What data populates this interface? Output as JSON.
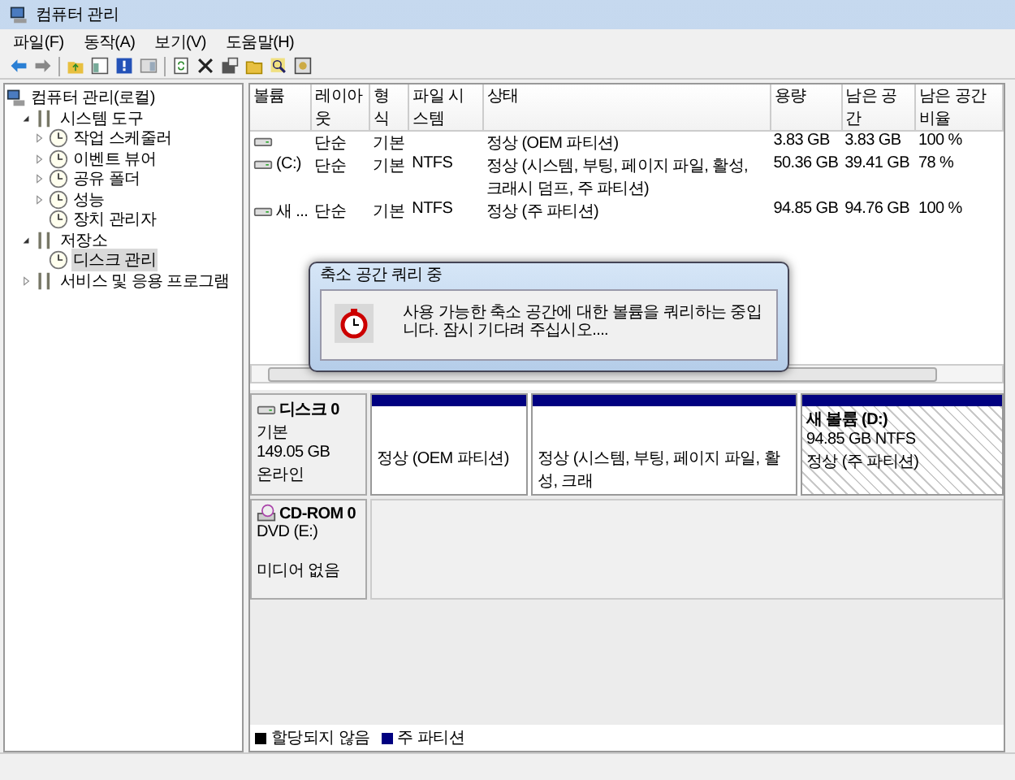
{
  "window": {
    "title": "컴퓨터 관리"
  },
  "menu": [
    "파일(F)",
    "동작(A)",
    "보기(V)",
    "도움말(H)"
  ],
  "tree": [
    {
      "label": "컴퓨터 관리(로컬)",
      "selected": false,
      "children": [
        {
          "label": "시스템 도구",
          "expanded": true,
          "selected": false,
          "children": [
            {
              "label": "작업 스케줄러",
              "expanded": false,
              "selected": false
            },
            {
              "label": "이벤트 뷰어",
              "expanded": false,
              "selected": false
            },
            {
              "label": "공유 폴더",
              "expanded": false,
              "selected": false
            },
            {
              "label": "성능",
              "expanded": false,
              "selected": false
            },
            {
              "label": "장치 관리자",
              "selected": false
            }
          ]
        },
        {
          "label": "저장소",
          "expanded": true,
          "selected": false,
          "children": [
            {
              "label": "디스크 관리",
              "selected": true
            }
          ]
        },
        {
          "label": "서비스 및 응용 프로그램",
          "expanded": false,
          "selected": false
        }
      ]
    }
  ],
  "volumes": {
    "columns": [
      "볼륨",
      "레이아웃",
      "형식",
      "파일 시스템",
      "상태",
      "용량",
      "남은 공간",
      "남은 공간 비율"
    ],
    "rows": [
      {
        "volume": "",
        "layout": "단순",
        "type": "기본",
        "fs": "",
        "status": "정상 (OEM 파티션)",
        "capacity": "3.83 GB",
        "free": "3.83 GB",
        "percent": "100 %"
      },
      {
        "volume": "(C:)",
        "layout": "단순",
        "type": "기본",
        "fs": "NTFS",
        "status": "정상 (시스템, 부팅, 페이지 파일, 활성, 크래시 덤프, 주 파티션)",
        "capacity": "50.36 GB",
        "free": "39.41 GB",
        "percent": "78 %"
      },
      {
        "volume": "새 ...",
        "layout": "단순",
        "type": "기본",
        "fs": "NTFS",
        "status": "정상 (주 파티션)",
        "capacity": "94.85 GB",
        "free": "94.76 GB",
        "percent": "100 %"
      }
    ]
  },
  "disks": [
    {
      "kind": "disk",
      "name": "디스크 0",
      "lines": [
        "기본",
        "149.05 GB",
        "온라인"
      ],
      "partitions": [
        {
          "status": "정상 (OEM 파티션)",
          "selected": false
        },
        {
          "status": "정상 (시스템, 부팅, 페이지 파일, 활성, 크래",
          "selected": false
        },
        {
          "name": "새 볼륨  (D:)",
          "size": "94.85 GB NTFS",
          "status": "정상 (주 파티션)",
          "selected": true
        }
      ]
    },
    {
      "kind": "cdrom",
      "name": "CD-ROM 0",
      "lines": [
        "DVD (E:)",
        "미디어 없음"
      ]
    }
  ],
  "legend": [
    {
      "label": "할당되지 않음",
      "color": "#000000"
    },
    {
      "label": "주 파티션",
      "color": "#000080"
    }
  ],
  "dialog": {
    "title": "축소 공간 쿼리 중",
    "message": "사용 가능한 축소 공간에 대한 볼륨을 쿼리하는 중입니다. 잠시 기다려 주십시오...."
  }
}
